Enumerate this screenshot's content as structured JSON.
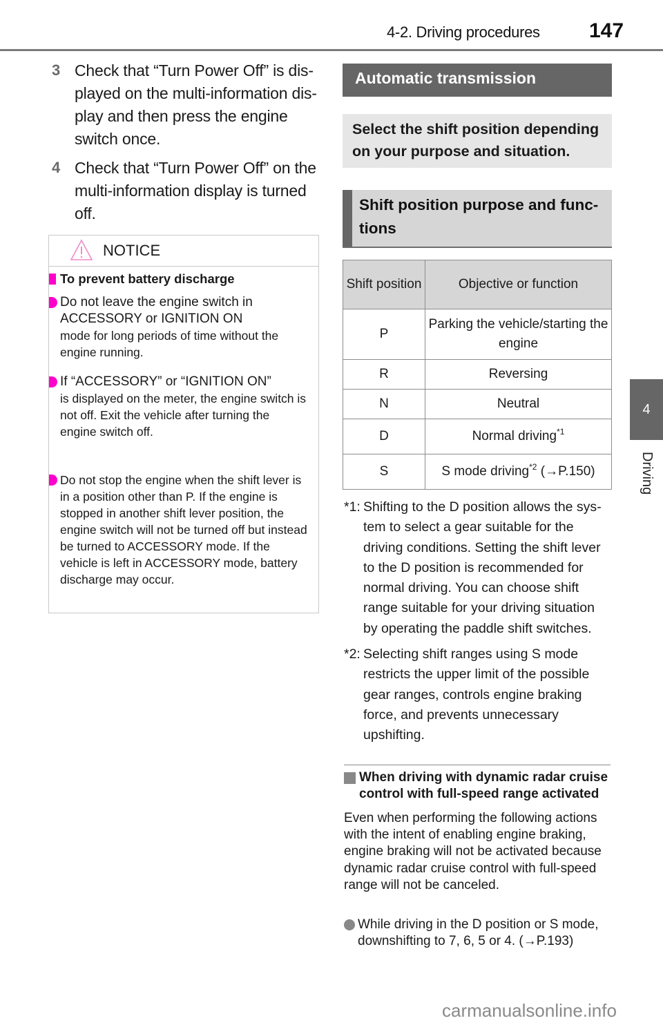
{
  "header": {
    "section": "4-2. Driving procedures",
    "page_number": "147"
  },
  "side_tab": {
    "chapter_number": "4",
    "chapter_label": "Driving"
  },
  "steps": [
    {
      "number": "3",
      "text": "Check that “Turn Power Off” is dis­played on the multi-information dis­play and then press the engine switch once."
    },
    {
      "number": "4",
      "text": "Check that “Turn Power Off” on the multi-information display is turned off."
    }
  ],
  "notice": {
    "title": "NOTICE",
    "icon": "warning-triangle-icon",
    "subheading": "To prevent battery discharge",
    "bullets": [
      {
        "line1": "Do not leave the engine switch in ACCESSORY or IGNITION ON",
        "line2": "mode for long periods of time without the engine running."
      },
      {
        "line1": "If “ACCESSORY” or “IGNITION ON”",
        "line2": "is displayed on the meter, the engine switch is not off. Exit the vehicle after turning the engine switch off."
      },
      {
        "line1": "Do not stop the engine when the shift lever is in a position other than P. If the engine is stopped in another shift lever position, the engine switch will not be turned off but instead be turned to ACCESSORY mode. If the vehicle is left in ACCESSORY mode, battery discharge may occur.",
        "line2": ""
      }
    ]
  },
  "right": {
    "section_title": "Automatic transmission",
    "intro": "Select the shift position depending on your purpose and situation.",
    "subsection_title": "Shift position purpose and func­tions",
    "table": {
      "headers": [
        "Shift posi­tion",
        "Objective or function"
      ],
      "rows": [
        {
          "position": "P",
          "function": "Parking the vehicle/starting the engine",
          "sup": "",
          "suffix": ""
        },
        {
          "position": "R",
          "function": "Reversing",
          "sup": "",
          "suffix": ""
        },
        {
          "position": "N",
          "function": "Neutral",
          "sup": "",
          "suffix": ""
        },
        {
          "position": "D",
          "function": "Normal driving",
          "sup": "*1",
          "suffix": ""
        },
        {
          "position": "S",
          "function": "S mode driving",
          "sup": "*2",
          "suffix": " (→P.150)"
        }
      ]
    },
    "footnotes": [
      {
        "mark": "*1:",
        "text": "Shifting to the D position allows the sys­tem to select a gear suitable for the driving conditions. Setting the shift lever to the D position is recommended for normal driving. You can choose shift range suitable for your driving situation by operating the paddle shift switches."
      },
      {
        "mark": "*2:",
        "text": "Selecting shift ranges using S mode restricts the upper limit of the possible gear ranges, controls engine braking force, and prevents unnecessary upshifting."
      }
    ],
    "info_heading": "When driving with dynamic radar cruise control with full-speed range activated",
    "info_body": "Even when performing the following actions with the intent of enabling engine braking, engine braking will not be acti­vated because dynamic radar cruise con­trol with full-speed range will not be canceled.",
    "info_bullet": "While driving in the D position or S mode, downshifting to 7, 6, 5 or 4. (→P.193)"
  },
  "watermark": "carmanualsonline.info",
  "colors": {
    "accent_pink": "#ff00cc",
    "tab_grey": "#666666",
    "light_box": "#e6e6e6",
    "table_header": "#d6d6d6"
  }
}
